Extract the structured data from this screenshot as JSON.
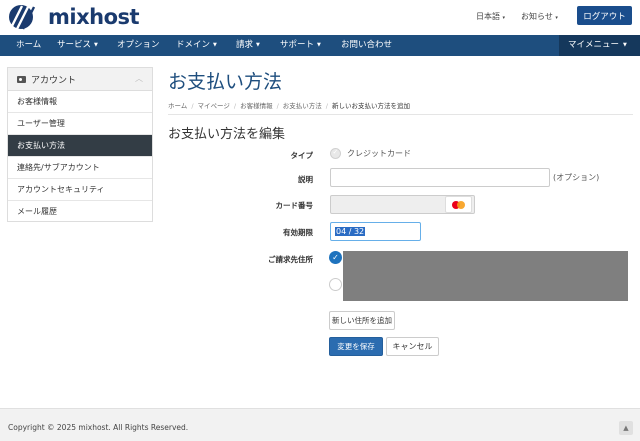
{
  "header": {
    "logo_text": "mixhost",
    "language": "日本語",
    "notices": "お知らせ",
    "logout": "ログアウト",
    "brand_color": "#1a3a6e",
    "nav_color": "#1e4e7e"
  },
  "nav": {
    "items": [
      {
        "label": "ホーム",
        "caret": false
      },
      {
        "label": "サービス",
        "caret": true
      },
      {
        "label": "オプション",
        "caret": false
      },
      {
        "label": "ドメイン",
        "caret": true
      },
      {
        "label": "請求",
        "caret": true
      },
      {
        "label": "サポート",
        "caret": true
      },
      {
        "label": "お問い合わせ",
        "caret": false
      }
    ],
    "my_menu": "マイメニュー"
  },
  "sidebar": {
    "title": "アカウント",
    "items": [
      {
        "label": "お客様情報"
      },
      {
        "label": "ユーザー管理"
      },
      {
        "label": "お支払い方法"
      },
      {
        "label": "連絡先/サブアカウント"
      },
      {
        "label": "アカウントセキュリティ"
      },
      {
        "label": "メール履歴"
      }
    ],
    "active_index": 2
  },
  "main": {
    "page_title": "お支払い方法",
    "breadcrumb": [
      "ホーム",
      "マイページ",
      "お客様情報",
      "お支払い方法",
      "新しいお支払い方法を追加"
    ],
    "section_title": "お支払い方法を編集",
    "form": {
      "type_label": "タイプ",
      "type_value": "クレジットカード",
      "description_label": "説明",
      "description_value": "",
      "optional_text": "(オプション)",
      "card_number_label": "カード番号",
      "card_number_value": "",
      "card_icon": "mastercard-icon",
      "expiry_label": "有効期限",
      "expiry_value": "04 / 32",
      "billing_label": "ご請求先住所",
      "add_address": "新しい住所を追加",
      "save": "変更を保存",
      "cancel": "キャンセル"
    }
  },
  "footer": {
    "copyright": "Copyright © 2025 mixhost. All Rights Reserved.",
    "to_top": "▲"
  }
}
